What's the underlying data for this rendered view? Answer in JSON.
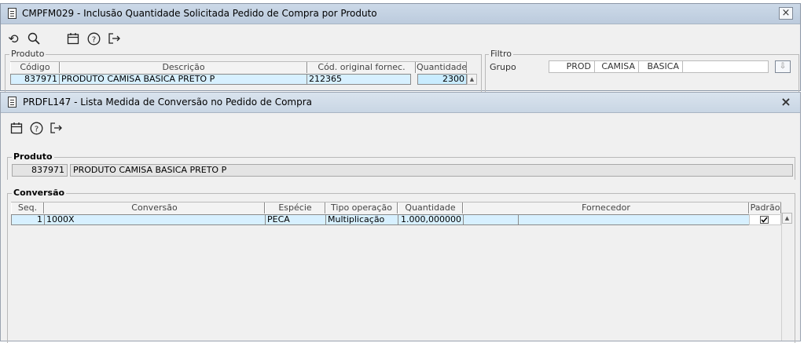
{
  "back_window": {
    "title": "CMPFM029 - Inclusão Quantidade Solicitada  Pedido de Compra por Produto",
    "close": "×",
    "produto_section": "Produto",
    "columns": [
      "Código",
      "Descrição",
      "Cód. original fornec.",
      "Quantidade"
    ],
    "row": {
      "codigo": "837971",
      "descricao": "PRODUTO CAMISA BASICA PRETO P",
      "cod_original": "212365",
      "quantidade": "2300"
    },
    "filtro_section": "Filtro",
    "grupo_label": "Grupo",
    "grupo_values": [
      "PROD",
      "CAMISA",
      "BASICA"
    ],
    "grupo_button": "⇩",
    "toolbar_icons": [
      "undo-icon",
      "search-icon",
      "calendar-icon",
      "help-icon",
      "exit-icon"
    ]
  },
  "front_window": {
    "title": "PRDFL147 - Lista Medida de Conversão no Pedido de Compra",
    "close": "×",
    "toolbar_icons": [
      "calendar-icon",
      "help-icon",
      "exit-icon"
    ],
    "produto_section": "Produto",
    "produto_codigo": "837971",
    "produto_descricao": "PRODUTO CAMISA BASICA PRETO P",
    "conversao_section": "Conversão",
    "columns": [
      "Seq.",
      "Conversão",
      "Espécie",
      "Tipo operação",
      "Quantidade",
      "Fornecedor",
      "Padrão"
    ],
    "row": {
      "seq": "1",
      "conversao": "1000X",
      "especie": "PECA",
      "tipo_operacao": "Multiplicação",
      "quantidade": "1.000,000000",
      "fornecedor_cod": "",
      "fornecedor_nome": "",
      "padrao_checked": true
    }
  }
}
